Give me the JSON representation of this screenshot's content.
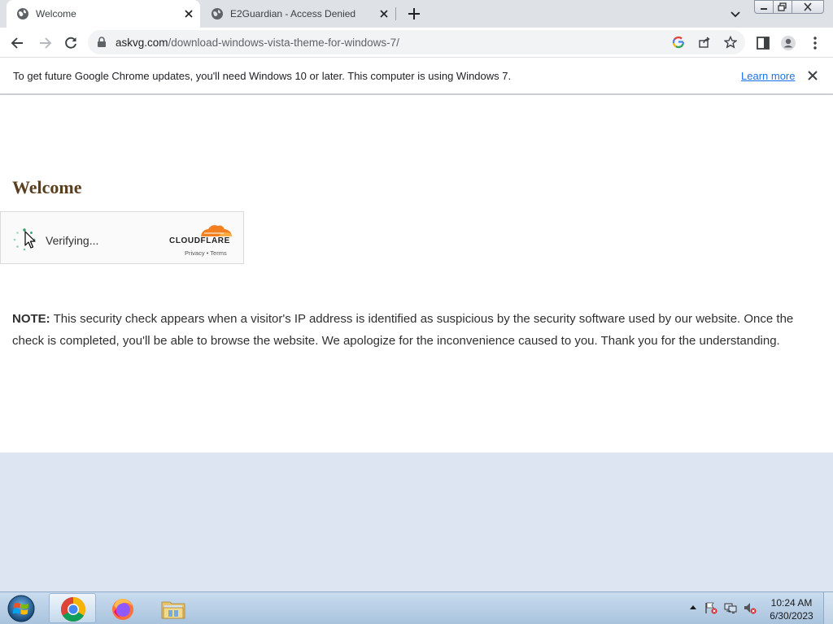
{
  "browser": {
    "tabs": [
      {
        "title": "Welcome",
        "active": true
      },
      {
        "title": "E2Guardian - Access Denied",
        "active": false
      }
    ],
    "address": {
      "host": "askvg.com",
      "path": "/download-windows-vista-theme-for-windows-7/"
    },
    "infobar": {
      "message": "To get future Google Chrome updates, you'll need Windows 10 or later. This computer is using Windows 7.",
      "link": "Learn more"
    }
  },
  "page": {
    "title": "Welcome",
    "captcha": {
      "status": "Verifying...",
      "brand": "CLOUDFLARE",
      "privacy": "Privacy",
      "separator": "•",
      "terms": "Terms"
    },
    "note": {
      "label": "NOTE:",
      "text": " This security check appears when a visitor's IP address is identified as suspicious by the security software used by our website. Once the check is completed, you'll be able to browse the website. We apologize for the inconvenience caused to you. Thank you for the understanding."
    }
  },
  "taskbar": {
    "apps": [
      "chrome-icon",
      "firefox-icon",
      "file-explorer-icon"
    ],
    "clock": {
      "time": "10:24 AM",
      "date": "6/30/2023"
    }
  },
  "colors": {
    "accent": "#1a73e8",
    "cloudflare_orange": "#f38020",
    "heading": "#5a3f1f",
    "desktop_background": "#dde5f3"
  }
}
